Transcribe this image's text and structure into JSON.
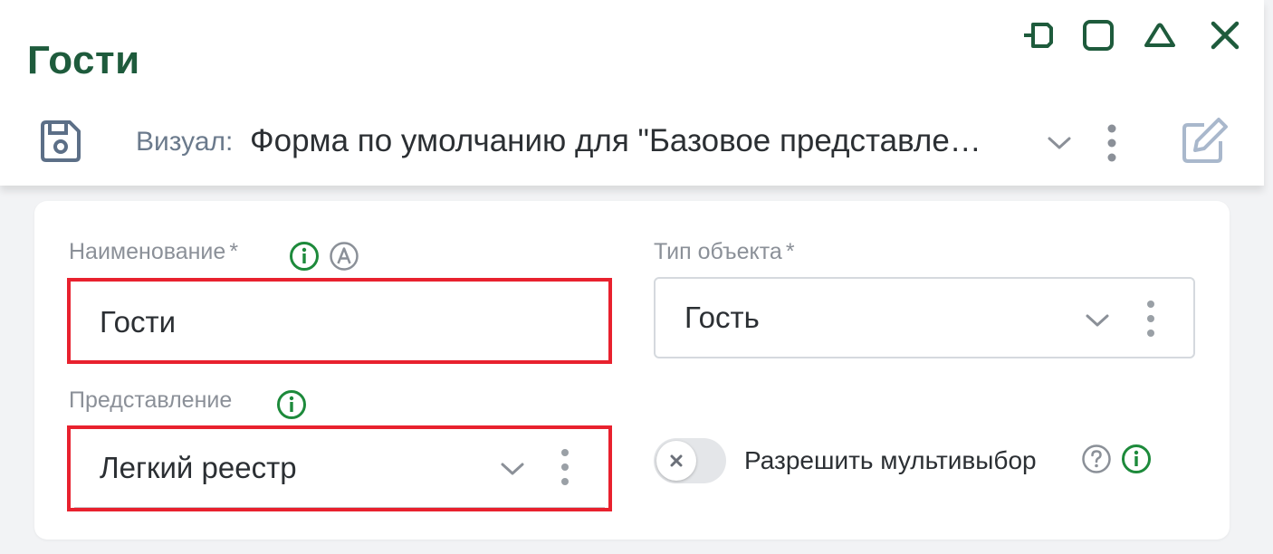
{
  "window": {
    "title": "Гости",
    "controls": [
      "pin-icon",
      "maximize-icon",
      "collapse-icon",
      "close-icon"
    ]
  },
  "toolbar": {
    "save_icon": "save-icon",
    "visual_label": "Визуал:",
    "visual_value": "Форма по умолчанию для \"Базовое представле…",
    "edit_icon": "edit-icon"
  },
  "form": {
    "name": {
      "label": "Наименование",
      "required": "*",
      "value": "Гости",
      "info_icon": "info-icon",
      "auto_icon": "auto-a-icon"
    },
    "object_type": {
      "label": "Тип объекта",
      "required": "*",
      "value": "Гость"
    },
    "view": {
      "label": "Представление",
      "value": "Легкий реестр",
      "info_icon": "info-icon"
    },
    "multiselect": {
      "label": "Разрешить мультивыбор",
      "enabled": false,
      "help_icon": "help-icon",
      "info_icon": "info-icon"
    }
  },
  "colors": {
    "title_green": "#1e5b3c",
    "info_green": "#1d8a3b",
    "highlight_red": "#e8212e",
    "muted_blue": "#5c6f87"
  }
}
